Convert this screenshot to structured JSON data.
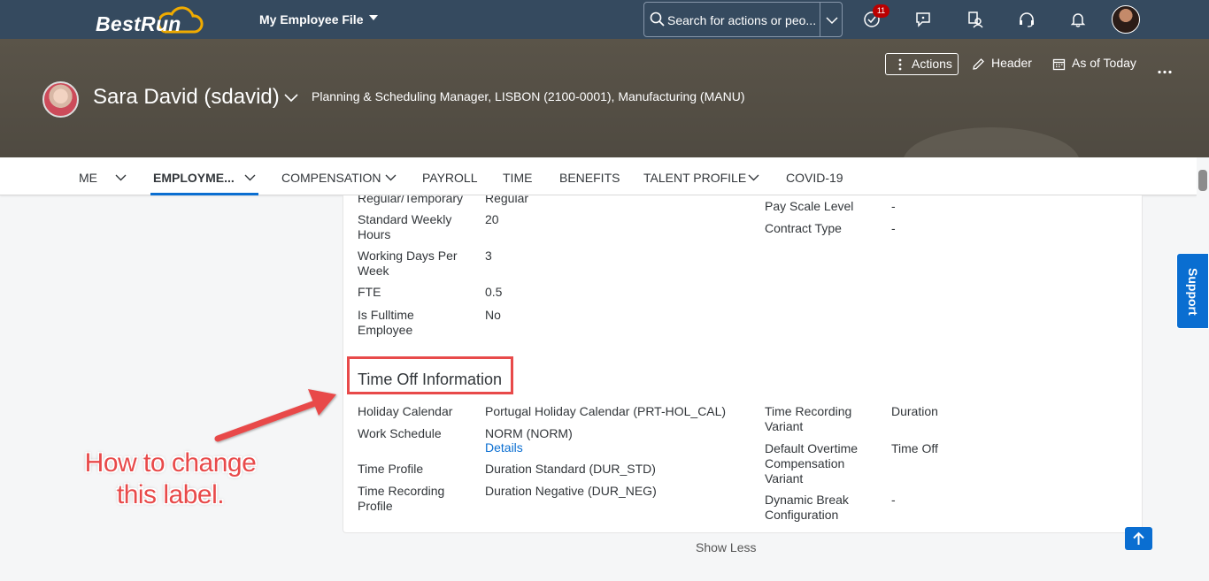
{
  "shell": {
    "logo": "BestRun",
    "app_title": "My Employee File",
    "search_placeholder": "Search for actions or peo...",
    "notification_count": "11",
    "icons": [
      "todo-icon",
      "feedback-icon",
      "people-icon",
      "headset-icon",
      "bell-icon"
    ]
  },
  "header": {
    "actions_label": "Actions",
    "header_label": "Header",
    "as_of_label": "As of Today",
    "employee_name": "Sara David (sdavid)",
    "employee_info": "Planning & Scheduling Manager, LISBON (2100-0001), Manufacturing (MANU)"
  },
  "tabs": [
    {
      "label": "ME",
      "dropdown": true
    },
    {
      "label": "EMPLOYME...",
      "dropdown": true,
      "active": true
    },
    {
      "label": "COMPENSATION",
      "dropdown": true
    },
    {
      "label": "PAYROLL"
    },
    {
      "label": "TIME"
    },
    {
      "label": "BENEFITS"
    },
    {
      "label": "TALENT PROFILE",
      "dropdown": true
    },
    {
      "label": "COVID-19"
    }
  ],
  "job_info": {
    "left": [
      {
        "label": "Regular/Temporary",
        "value": "Regular"
      },
      {
        "label": "Standard Weekly Hours",
        "value": "20"
      },
      {
        "label": "Working Days Per Week",
        "value": "3"
      },
      {
        "label": "FTE",
        "value": "0.5"
      },
      {
        "label": "Is Fulltime Employee",
        "value": "No"
      }
    ],
    "right": [
      {
        "label": "Pay Scale Level",
        "value": "-"
      },
      {
        "label": "Contract Type",
        "value": "-"
      }
    ]
  },
  "time_off": {
    "title": "Time Off Information",
    "left": [
      {
        "label": "Holiday Calendar",
        "value": "Portugal Holiday Calendar (PRT-HOL_CAL)"
      },
      {
        "label": "Work Schedule",
        "value": "NORM (NORM)",
        "link": "Details"
      },
      {
        "label": "Time Profile",
        "value": "Duration Standard (DUR_STD)"
      },
      {
        "label": "Time Recording Profile",
        "value": "Duration Negative (DUR_NEG)"
      }
    ],
    "right": [
      {
        "label": "Time Recording Variant",
        "value": "Duration"
      },
      {
        "label": "Default Overtime Compensation Variant",
        "value": "Time Off"
      },
      {
        "label": "Dynamic Break Configuration",
        "value": "-"
      }
    ]
  },
  "show_less_label": "Show Less",
  "support_label": "Support",
  "annotation": {
    "line1": "How to change",
    "line2": "this label."
  },
  "colors": {
    "shell": "#354a5f",
    "accent": "#0a6ed1",
    "annotation": "#e84a4a"
  }
}
